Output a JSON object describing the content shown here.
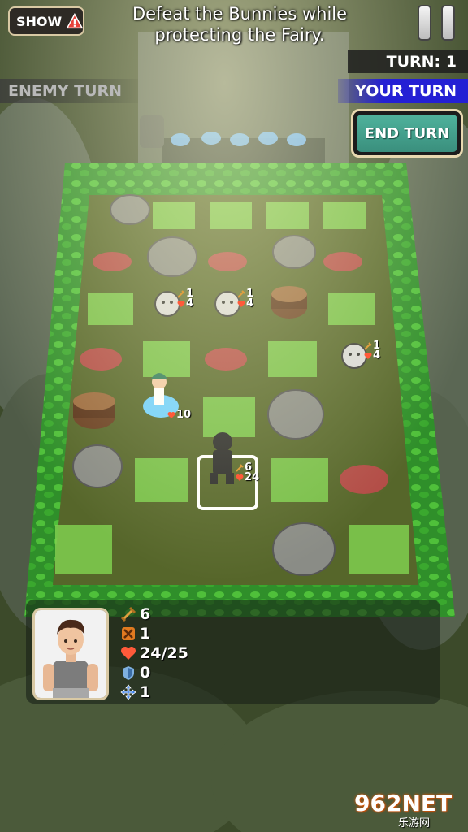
{
  "hud": {
    "show_label": "SHOW",
    "objective_line1": "Defeat the Bunnies while",
    "objective_line2": "protecting the Fairy.",
    "turn_label": "TURN: 1",
    "enemy_turn_label": "ENEMY TURN",
    "your_turn_label": "YOUR TURN",
    "end_turn_label": "END TURN"
  },
  "units": [
    {
      "name": "bunny",
      "attack": "1",
      "health": "4"
    },
    {
      "name": "bunny",
      "attack": "1",
      "health": "4"
    },
    {
      "name": "bunny",
      "attack": "1",
      "health": "4"
    },
    {
      "name": "fairy",
      "health": "10"
    },
    {
      "name": "hero",
      "attack": "6",
      "health": "24"
    }
  ],
  "selected_unit": {
    "attack": "6",
    "range": "1",
    "health": "24/25",
    "defense": "0",
    "movement": "1"
  },
  "watermark": {
    "main": "962NET",
    "sub": "乐游网"
  },
  "colors": {
    "your_turn_bg": "#2420d4",
    "end_turn_bg": "#4fb29c",
    "attack_icon": "#e0a040",
    "health_icon": "#ff5a3a",
    "defense_icon": "#7fb0e0",
    "movement_icon": "#3a7fe8"
  }
}
